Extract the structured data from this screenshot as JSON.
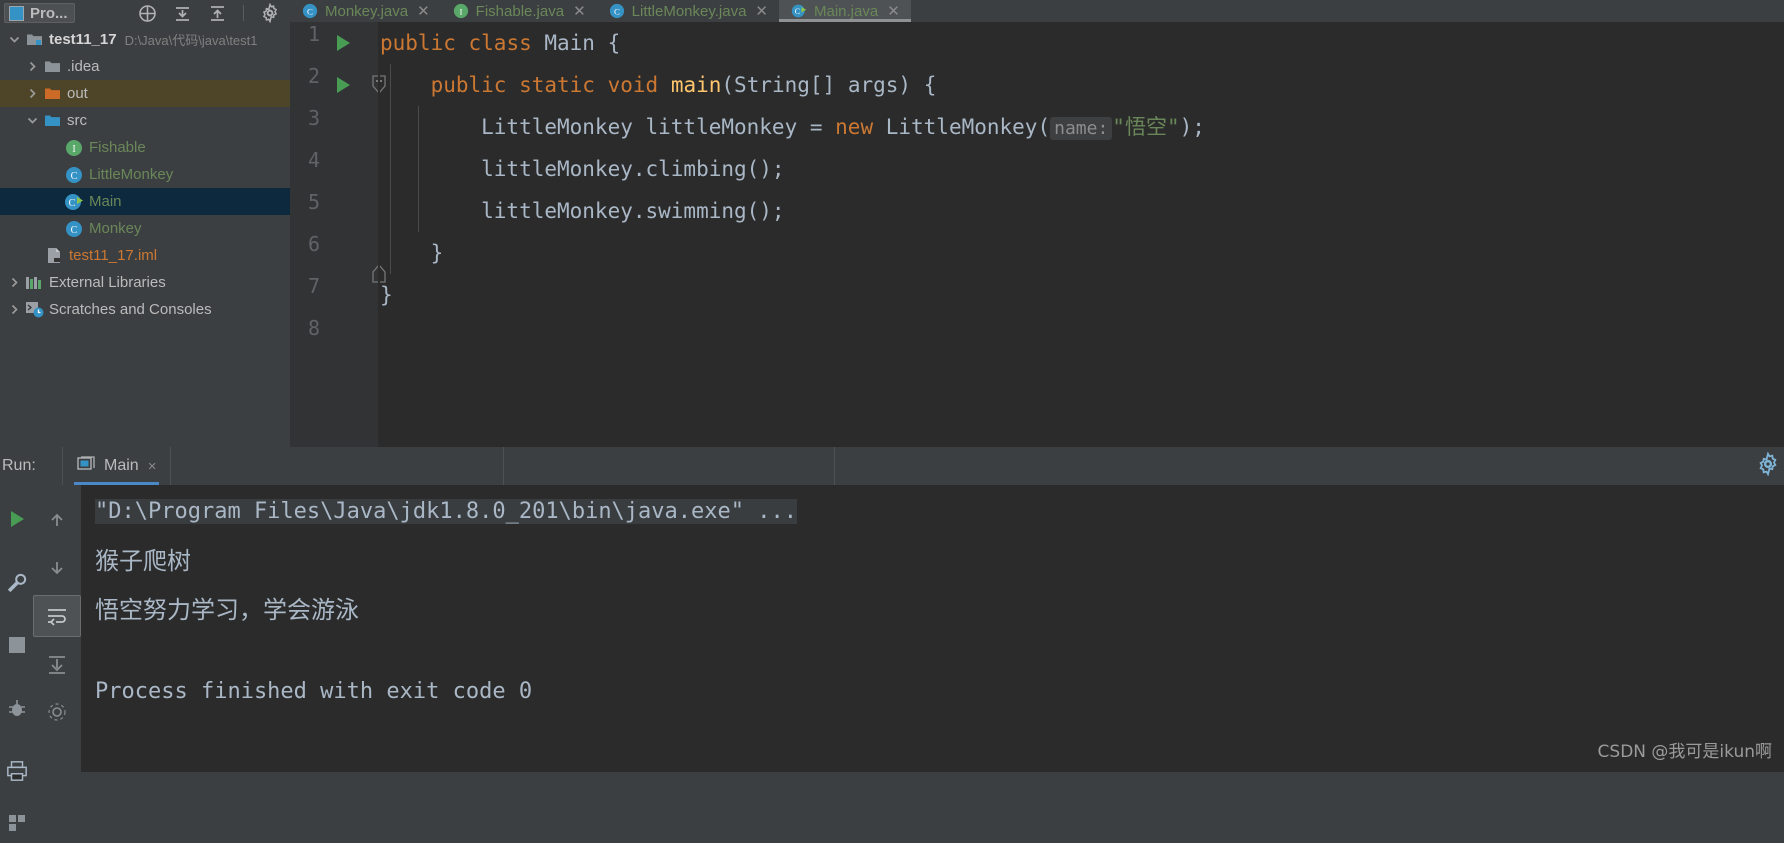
{
  "window": {
    "theme_bg": "#3c3f41",
    "editor_bg": "#2b2b2b",
    "accent": "#4a88c7"
  },
  "tool_window": {
    "title": "Pro...",
    "actions": [
      "locate-icon",
      "collapse-all-icon",
      "expand-icon",
      "settings-gear-icon"
    ]
  },
  "project_tree": {
    "items": [
      {
        "label": "test11_17",
        "path": "D:\\Java\\代码\\java\\test1",
        "icon": "module-folder-icon",
        "arrow": "expanded",
        "indent": 0,
        "state": "bold"
      },
      {
        "label": ".idea",
        "path": "",
        "icon": "folder-gray-icon",
        "arrow": "collapsed",
        "indent": 1,
        "state": "normal"
      },
      {
        "label": "out",
        "path": "",
        "icon": "folder-orange-icon",
        "arrow": "collapsed",
        "indent": 1,
        "state": "highlight"
      },
      {
        "label": "src",
        "path": "",
        "icon": "folder-source-icon",
        "arrow": "expanded",
        "indent": 1,
        "state": "normal"
      },
      {
        "label": "Fishable",
        "path": "",
        "icon": "interface-icon",
        "arrow": "none",
        "indent": 2,
        "state": "green"
      },
      {
        "label": "LittleMonkey",
        "path": "",
        "icon": "class-icon",
        "arrow": "none",
        "indent": 2,
        "state": "green"
      },
      {
        "label": "Main",
        "path": "",
        "icon": "class-runnable-icon",
        "arrow": "none",
        "indent": 2,
        "state": "selected"
      },
      {
        "label": "Monkey",
        "path": "",
        "icon": "class-icon",
        "arrow": "none",
        "indent": 2,
        "state": "green"
      },
      {
        "label": "test11_17.iml",
        "path": "",
        "icon": "iml-file-icon",
        "arrow": "none",
        "indent": 1,
        "state": "orange"
      },
      {
        "label": "External Libraries",
        "path": "",
        "icon": "libraries-icon",
        "arrow": "collapsed",
        "indent": 0,
        "state": "normal"
      },
      {
        "label": "Scratches and Consoles",
        "path": "",
        "icon": "scratches-icon",
        "arrow": "collapsed",
        "indent": 0,
        "state": "normal"
      }
    ]
  },
  "editor_tabs": [
    {
      "label": "Monkey.java",
      "icon": "class-icon",
      "active": false
    },
    {
      "label": "Fishable.java",
      "icon": "interface-icon",
      "active": false
    },
    {
      "label": "LittleMonkey.java",
      "icon": "class-icon",
      "active": false
    },
    {
      "label": "Main.java",
      "icon": "class-runnable-icon",
      "active": true
    }
  ],
  "editor": {
    "line_numbers": [
      "1",
      "2",
      "3",
      "4",
      "5",
      "6",
      "7",
      "8"
    ],
    "code_lines": [
      {
        "n": 1,
        "segments": [
          {
            "t": "public ",
            "c": "k"
          },
          {
            "t": "class ",
            "c": "k"
          },
          {
            "t": "Main",
            "c": "cls"
          },
          {
            "t": " {",
            "c": "pun"
          }
        ]
      },
      {
        "n": 2,
        "segments": [
          {
            "t": "    ",
            "c": "pun"
          },
          {
            "t": "public ",
            "c": "k"
          },
          {
            "t": "static ",
            "c": "k"
          },
          {
            "t": "void ",
            "c": "k"
          },
          {
            "t": "main",
            "c": "mth"
          },
          {
            "t": "(String[] args) {",
            "c": "pun"
          }
        ]
      },
      {
        "n": 3,
        "segments": [
          {
            "t": "        LittleMonkey littleMonkey = ",
            "c": "pun"
          },
          {
            "t": "new ",
            "c": "k"
          },
          {
            "t": "LittleMonkey(",
            "c": "pun"
          },
          {
            "t": "name:",
            "c": "hint"
          },
          {
            "t": "\"悟空\"",
            "c": "str"
          },
          {
            "t": ");",
            "c": "pun"
          }
        ]
      },
      {
        "n": 4,
        "segments": [
          {
            "t": "        littleMonkey.climbing();",
            "c": "pun"
          }
        ]
      },
      {
        "n": 5,
        "segments": [
          {
            "t": "        littleMonkey.swimming();",
            "c": "pun"
          }
        ]
      },
      {
        "n": 6,
        "segments": [
          {
            "t": "    }",
            "c": "pun"
          }
        ]
      },
      {
        "n": 7,
        "segments": [
          {
            "t": "}",
            "c": "pun"
          }
        ]
      },
      {
        "n": 8,
        "segments": [
          {
            "t": "",
            "c": "pun"
          }
        ]
      }
    ],
    "gutter_run_markers": [
      1,
      2
    ],
    "gutter_fold_markers": [
      2,
      6
    ]
  },
  "run_window": {
    "label": "Run:",
    "tab_label": "Main",
    "close_label": "×",
    "side_buttons": [
      "rerun-icon",
      "wrench-icon",
      "stop-icon",
      "print-icon"
    ],
    "side_buttons2": [
      "scroll-up-icon",
      "scroll-down-icon",
      "soft-wrap-icon",
      "scroll-to-end-icon"
    ],
    "gear": "gear-icon",
    "console_lines": [
      {
        "text": "\"D:\\Program Files\\Java\\jdk1.8.0_201\\bin\\java.exe\" ...",
        "cjk": false,
        "selected": true
      },
      {
        "text": "猴子爬树",
        "cjk": true,
        "selected": false
      },
      {
        "text": "悟空努力学习，学会游泳",
        "cjk": true,
        "selected": false
      },
      {
        "text": "",
        "cjk": false,
        "selected": false
      },
      {
        "text": "Process finished with exit code 0",
        "cjk": false,
        "selected": false
      }
    ]
  },
  "watermark": {
    "text": "CSDN @我可是ikun啊"
  }
}
